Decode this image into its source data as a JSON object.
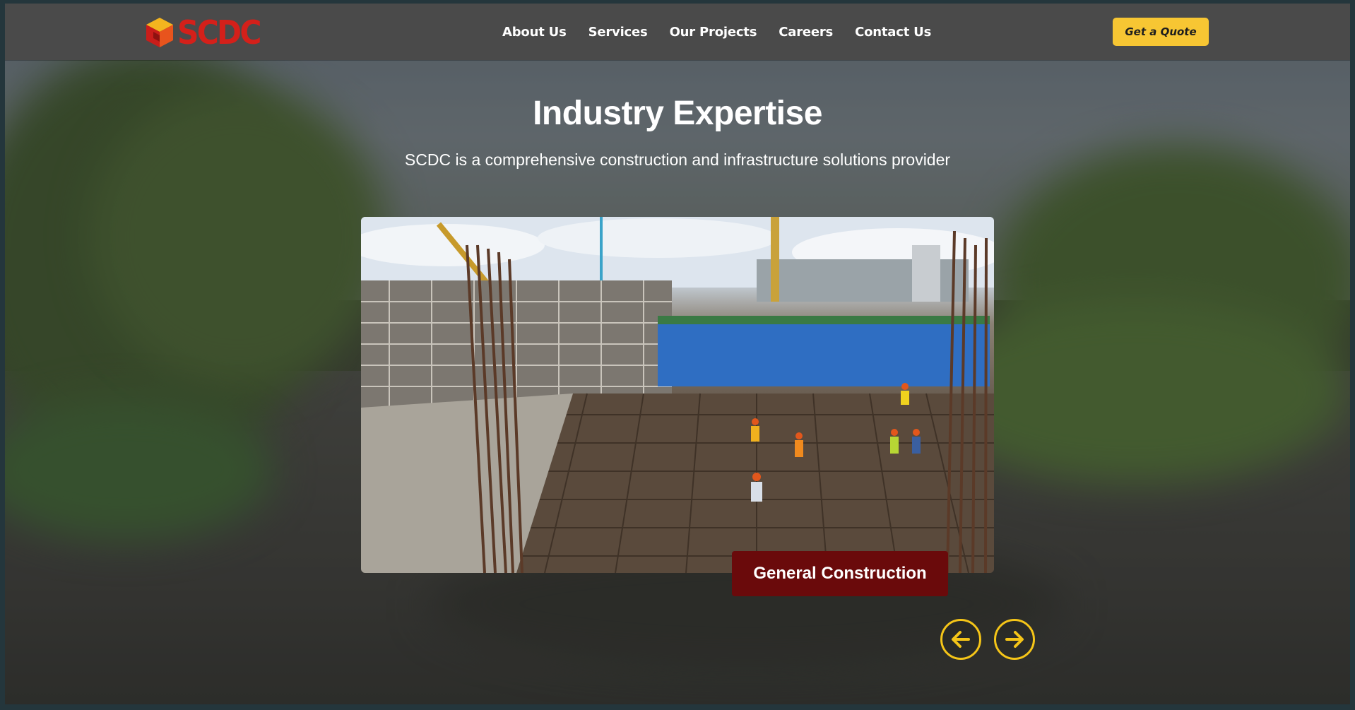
{
  "brand": {
    "name": "SCDC",
    "logo_icon": "cube-logo-icon"
  },
  "nav": {
    "items": [
      {
        "label": "About Us"
      },
      {
        "label": "Services"
      },
      {
        "label": "Our Projects"
      },
      {
        "label": "Careers"
      },
      {
        "label": "Contact Us"
      }
    ],
    "cta_label": "Get a Quote"
  },
  "hero": {
    "title": "Industry Expertise",
    "subtitle": "SCDC is a comprehensive construction and infrastructure solutions provider"
  },
  "carousel": {
    "active_caption": "General Construction",
    "prev_icon": "arrow-left-icon",
    "next_icon": "arrow-right-icon"
  },
  "colors": {
    "accent": "#f7c633",
    "brand_red": "#d4201a",
    "caption_bg": "#6a0a0b",
    "nav_bg": "#4a4a4a"
  }
}
